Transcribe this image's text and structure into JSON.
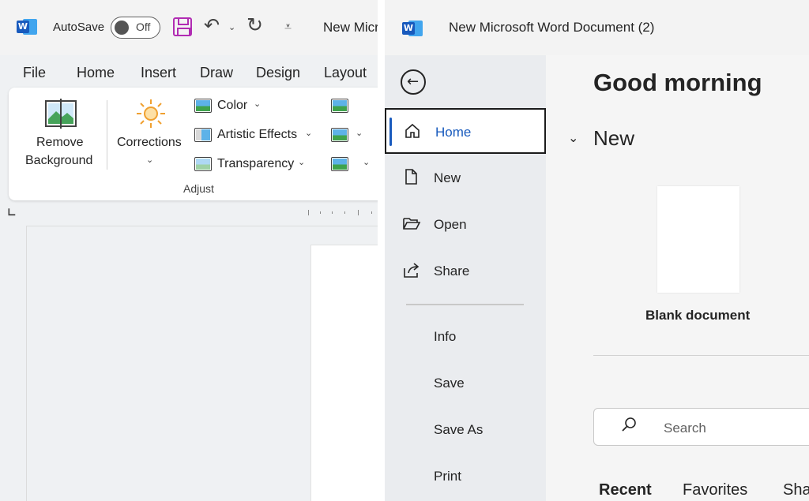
{
  "left_window": {
    "autosave_label": "AutoSave",
    "autosave_state": "Off",
    "doc_title_partial": "New Micr",
    "menu": [
      "File",
      "Home",
      "Insert",
      "Draw",
      "Design",
      "Layout"
    ],
    "ribbon": {
      "remove_background": [
        "Remove",
        "Background"
      ],
      "corrections": "Corrections",
      "color": "Color",
      "artistic_effects": "Artistic Effects",
      "transparency": "Transparency",
      "group_label": "Adjust"
    }
  },
  "right_window": {
    "title": "New Microsoft Word Document (2)",
    "nav": {
      "items": [
        {
          "label": "Home",
          "icon": "home-icon",
          "selected": true
        },
        {
          "label": "New",
          "icon": "new-doc-icon"
        },
        {
          "label": "Open",
          "icon": "folder-open-icon"
        },
        {
          "label": "Share",
          "icon": "share-icon"
        },
        {
          "label": "Info"
        },
        {
          "label": "Save"
        },
        {
          "label": "Save As"
        },
        {
          "label": "Print"
        }
      ]
    },
    "main": {
      "greeting": "Good morning",
      "new_heading": "New",
      "blank_document_label": "Blank document",
      "search_placeholder": "Search",
      "tabs": [
        "Recent",
        "Favorites",
        "Sha"
      ]
    }
  },
  "colors": {
    "word_blue": "#185abd",
    "save_purple": "#b12cb3",
    "nav_background": "#eaecef"
  }
}
